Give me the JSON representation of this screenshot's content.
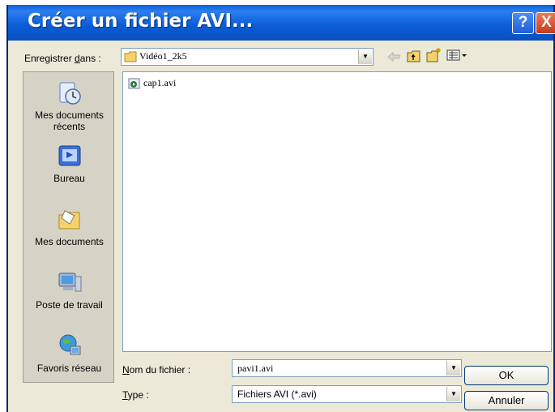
{
  "window": {
    "title": "Créer un fichier AVI...",
    "help_glyph": "?",
    "close_glyph": "X"
  },
  "save_in": {
    "label_pre": "Enregistrer ",
    "label_accel": "d",
    "label_post": "ans :",
    "value": "Vidéo1_2k5"
  },
  "toolbar": {
    "icons": [
      "back-icon",
      "up-folder-icon",
      "new-folder-icon",
      "views-menu-icon"
    ]
  },
  "places": [
    {
      "label": "Mes documents récents",
      "icon": "recent-documents-icon"
    },
    {
      "label": "Bureau",
      "icon": "desktop-icon"
    },
    {
      "label": "Mes documents",
      "icon": "my-documents-icon"
    },
    {
      "label": "Poste de travail",
      "icon": "my-computer-icon"
    },
    {
      "label": "Favoris réseau",
      "icon": "network-places-icon"
    }
  ],
  "files": [
    {
      "name": "cap1.avi",
      "icon": "avi-file-icon"
    }
  ],
  "filename": {
    "label_accel": "N",
    "label_post": "om du fichier :",
    "value": "pavi1.avi"
  },
  "filetype": {
    "label_accel": "T",
    "label_post": "ype :",
    "value": "Fichiers AVI (*.avi)"
  },
  "buttons": {
    "ok": "OK",
    "cancel": "Annuler"
  },
  "colors": {
    "titlebar": "#0a5fd8",
    "dialog_bg": "#ece9d8",
    "close_button": "#c53a18"
  }
}
